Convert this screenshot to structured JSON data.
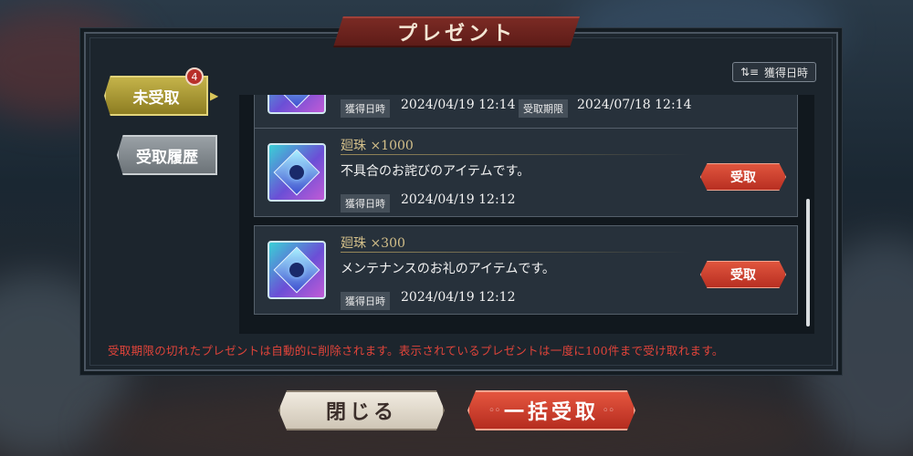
{
  "title": "プレゼント",
  "sort": {
    "label": "獲得日時",
    "icon": "sort-icon"
  },
  "tabs": {
    "unreceived": {
      "label": "未受取",
      "badge": "4"
    },
    "history": {
      "label": "受取履歴"
    }
  },
  "items": [
    {
      "acquired_label": "獲得日時",
      "acquired": "2024/04/19 12:14",
      "limit_label": "受取期限",
      "limit": "2024/07/18 12:14"
    },
    {
      "name": "廻珠 ×1000",
      "description": "不具合のお詫びのアイテムです。",
      "acquired_label": "獲得日時",
      "acquired": "2024/04/19 12:12",
      "button": "受取"
    },
    {
      "name": "廻珠 ×300",
      "description": "メンテナンスのお礼のアイテムです。",
      "acquired_label": "獲得日時",
      "acquired": "2024/04/19 12:12",
      "button": "受取"
    }
  ],
  "notice": "受取期限の切れたプレゼントは自動的に削除されます。表示されているプレゼントは一度に100件まで受け取れます。",
  "buttons": {
    "close": "閉じる",
    "claim_all": "一括受取"
  },
  "colors": {
    "accent_red": "#e0443a",
    "tab_gold": "#c4b34a",
    "receive_button": "#e0553e"
  }
}
